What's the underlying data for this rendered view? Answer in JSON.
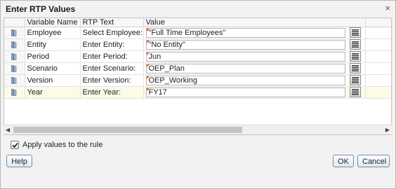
{
  "dialog": {
    "title": "Enter RTP Values",
    "close_glyph": "×"
  },
  "columns": {
    "variable_name": "Variable Name",
    "rtp_text": "RTP Text",
    "value": "Value"
  },
  "rows": [
    {
      "variable_name": "Employee",
      "rtp_text": "Select Employee:",
      "value": "\"Full Time Employees\""
    },
    {
      "variable_name": "Entity",
      "rtp_text": "Enter Entity:",
      "value": "\"No Entity\""
    },
    {
      "variable_name": "Period",
      "rtp_text": "Enter Period:",
      "value": "Jun"
    },
    {
      "variable_name": "Scenario",
      "rtp_text": "Enter Scenario:",
      "value": "OEP_Plan"
    },
    {
      "variable_name": "Version",
      "rtp_text": "Enter Version:",
      "value": "OEP_Working"
    },
    {
      "variable_name": "Year",
      "rtp_text": "Enter Year:",
      "value": "FY17",
      "selected": true
    }
  ],
  "scrollbar": {
    "left_glyph": "◀",
    "right_glyph": "▶"
  },
  "apply_values": {
    "label": "Apply values to the rule",
    "checked": true
  },
  "buttons": {
    "help": "Help",
    "ok": "OK",
    "cancel": "Cancel"
  },
  "colors": {
    "accent_marker": "#e86a10",
    "selected_row": "#fbfbe8",
    "button_border": "#6e8fb0"
  },
  "icons": {
    "row": "dimension-member-icon",
    "picker": "member-selector-icon"
  }
}
